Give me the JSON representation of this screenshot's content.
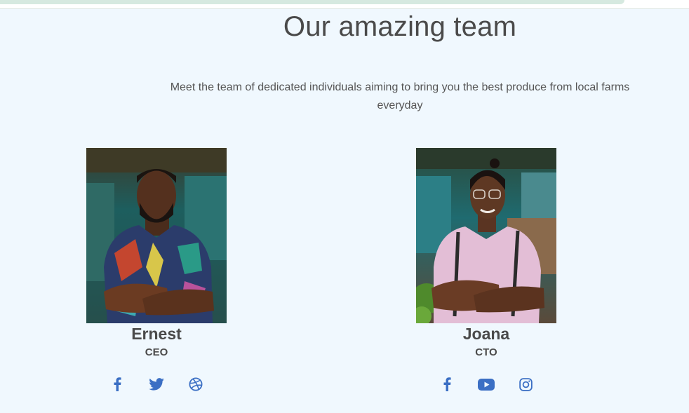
{
  "section": {
    "title": "Our amazing team",
    "subtitle": "Meet the team of dedicated individuals aiming to bring you the best produce from local farms everyday"
  },
  "members": [
    {
      "name": "Ernest",
      "role": "CEO",
      "socials": [
        "facebook-icon",
        "twitter-icon",
        "dribbble-icon"
      ]
    },
    {
      "name": "Joana",
      "role": "CTO",
      "socials": [
        "facebook-icon",
        "youtube-icon",
        "instagram-icon"
      ]
    }
  ],
  "colors": {
    "background": "#f0f8fe",
    "text": "#4a4a4a",
    "icon": "#3b6fc4"
  }
}
